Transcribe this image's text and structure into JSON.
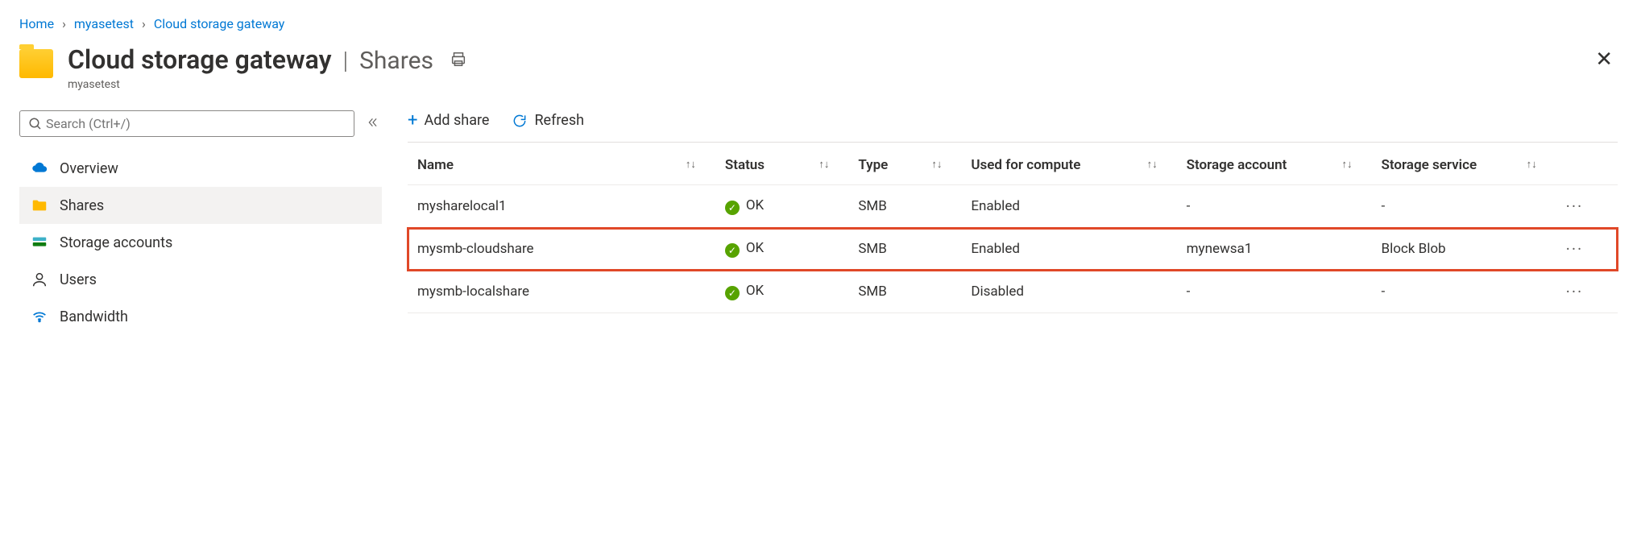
{
  "breadcrumb": {
    "home": "Home",
    "item1": "myasetest",
    "item2": "Cloud storage gateway"
  },
  "header": {
    "title": "Cloud storage gateway",
    "section": "Shares",
    "subtitle": "myasetest"
  },
  "search": {
    "placeholder": "Search (Ctrl+/)"
  },
  "nav": {
    "overview": "Overview",
    "shares": "Shares",
    "storage": "Storage accounts",
    "users": "Users",
    "bandwidth": "Bandwidth"
  },
  "toolbar": {
    "add": "Add share",
    "refresh": "Refresh"
  },
  "columns": {
    "name": "Name",
    "status": "Status",
    "type": "Type",
    "used": "Used for compute",
    "acct": "Storage account",
    "svc": "Storage service"
  },
  "rows": [
    {
      "name": "mysharelocal1",
      "status": "OK",
      "type": "SMB",
      "used": "Enabled",
      "acct": "-",
      "svc": "-",
      "hl": false
    },
    {
      "name": "mysmb-cloudshare",
      "status": "OK",
      "type": "SMB",
      "used": "Enabled",
      "acct": "mynewsa1",
      "svc": "Block Blob",
      "hl": true
    },
    {
      "name": "mysmb-localshare",
      "status": "OK",
      "type": "SMB",
      "used": "Disabled",
      "acct": "-",
      "svc": "-",
      "hl": false
    }
  ]
}
